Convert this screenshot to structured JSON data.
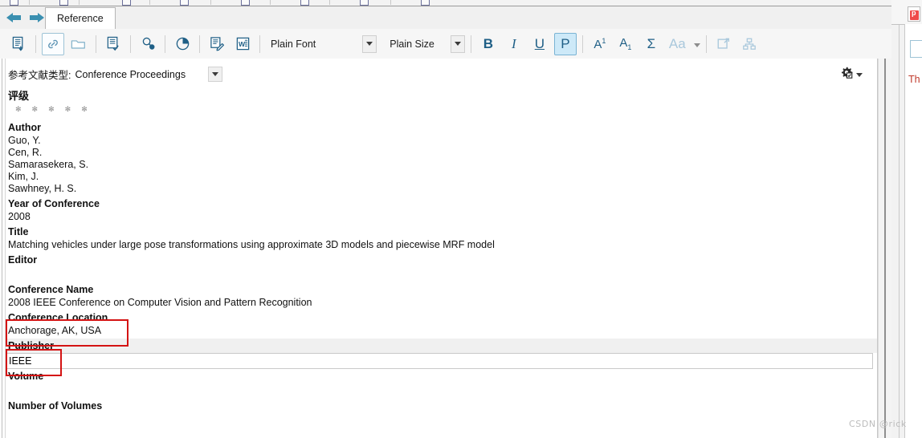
{
  "window": {
    "tab_label": "Reference"
  },
  "toolbar": {
    "icons": [
      {
        "name": "new-reference-icon",
        "title": "New Reference"
      },
      {
        "name": "attach-link-icon",
        "title": "Attach Link"
      },
      {
        "name": "open-folder-icon",
        "title": "Open Folder"
      },
      {
        "name": "edit-reference-icon",
        "title": "Edit Reference"
      },
      {
        "name": "find-reference-updates-icon",
        "title": "Find Reference Updates"
      },
      {
        "name": "chart-icon",
        "title": "Chart"
      },
      {
        "name": "edit-note-icon",
        "title": "Edit Note"
      },
      {
        "name": "word-export-icon",
        "title": "Export to Word"
      }
    ],
    "font_label": "Plain Font",
    "size_label": "Plain Size",
    "bold_label": "B",
    "italic_label": "I",
    "underline_label": "U",
    "plain_label": "P",
    "superscript_label": "A",
    "superscript_mark": "1",
    "subscript_label": "A",
    "subscript_mark": "1",
    "symbol_label": "Σ",
    "case_label": "Aa",
    "expand_icon_name": "expand-window-icon",
    "hierarchy_icon_name": "hierarchy-icon"
  },
  "reference": {
    "type_label": "参考文献类型:",
    "type_value": "Conference Proceedings",
    "rating_heading": "评级",
    "rating_stars": [
      "✻",
      "✻",
      "✻",
      "✻",
      "✻"
    ],
    "fields": [
      {
        "label": "Author",
        "lines": [
          "Guo, Y.",
          "Cen, R.",
          "Samarasekera, S.",
          "Kim, J.",
          "Sawhney, H. S."
        ],
        "highlighted": false,
        "annotated": false
      },
      {
        "label": "Year of Conference",
        "lines": [
          "2008"
        ],
        "highlighted": false,
        "annotated": false
      },
      {
        "label": "Title",
        "lines": [
          "Matching vehicles under large pose transformations using approximate 3D models and piecewise MRF model"
        ],
        "highlighted": false,
        "annotated": false
      },
      {
        "label": "Editor",
        "lines": [
          ""
        ],
        "highlighted": false,
        "annotated": false
      },
      {
        "label": "Conference Name",
        "lines": [
          "2008 IEEE Conference on Computer Vision and Pattern Recognition"
        ],
        "highlighted": false,
        "annotated": false
      },
      {
        "label": "Conference Location",
        "lines": [
          "Anchorage, AK, USA"
        ],
        "highlighted": false,
        "annotated": true
      },
      {
        "label": "Publisher",
        "lines": [
          "IEEE"
        ],
        "highlighted": true,
        "annotated": true
      },
      {
        "label": "Volume",
        "lines": [
          ""
        ],
        "highlighted": false,
        "annotated": false
      },
      {
        "label": "Number of Volumes",
        "lines": [
          ""
        ],
        "highlighted": false,
        "annotated": false
      }
    ]
  },
  "right_panel": {
    "text": "Th"
  },
  "watermark": {
    "text": "CSDN @rick"
  },
  "colors": {
    "accent_blue": "#1f5f86",
    "toggle_blue": "#cde9f8",
    "annotation_red": "#d41313",
    "row_highlight": "#f0f0f0"
  }
}
